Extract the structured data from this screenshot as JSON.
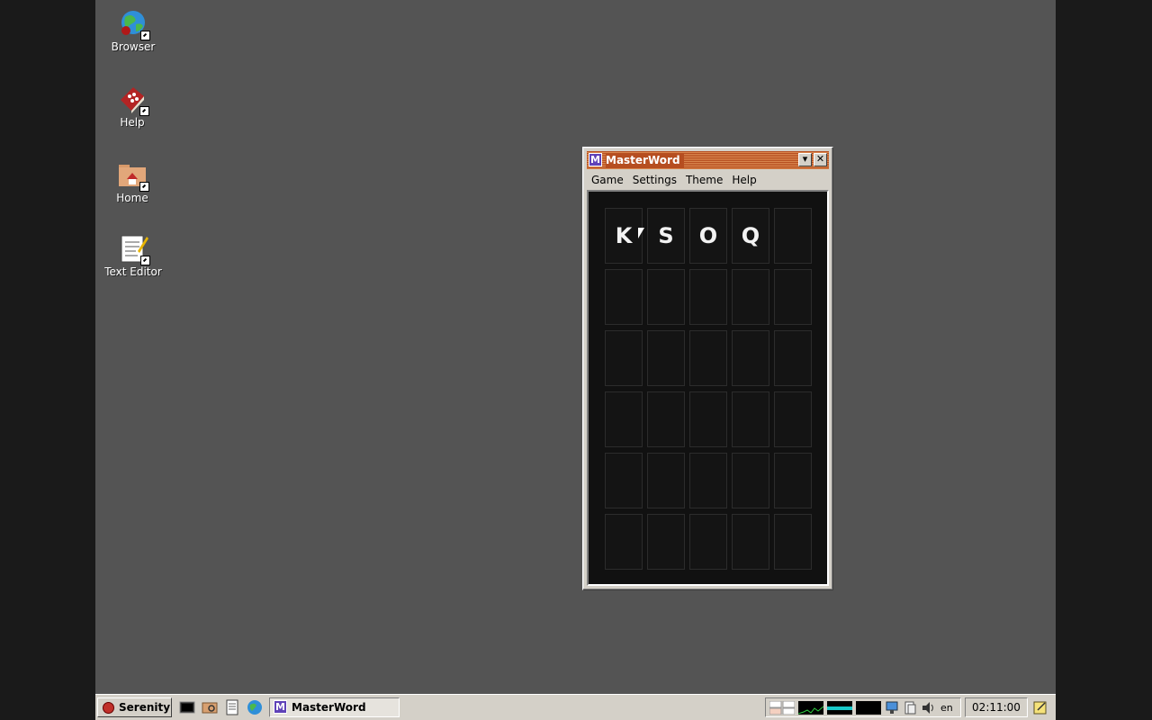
{
  "desktop": {
    "icons": [
      {
        "label": "Browser",
        "icon": "globe-icon"
      },
      {
        "label": "Help",
        "icon": "help-book-icon"
      },
      {
        "label": "Home",
        "icon": "home-folder-icon"
      },
      {
        "label": "Text Editor",
        "icon": "text-editor-icon"
      }
    ]
  },
  "window": {
    "title": "MasterWord",
    "app_icon_letter": "M",
    "menu": [
      "Game",
      "Settings",
      "Theme",
      "Help"
    ],
    "board": {
      "rows": [
        [
          "K",
          "S",
          "O",
          "Q",
          ""
        ],
        [
          "",
          "",
          "",
          "",
          ""
        ],
        [
          "",
          "",
          "",
          "",
          ""
        ],
        [
          "",
          "",
          "",
          "",
          ""
        ],
        [
          "",
          "",
          "",
          "",
          ""
        ],
        [
          "",
          "",
          "",
          "",
          ""
        ]
      ]
    }
  },
  "taskbar": {
    "start_label": "Serenity",
    "quick_launch": [
      "terminal-icon",
      "file-manager-icon",
      "text-editor-icon",
      "browser-icon"
    ],
    "task": {
      "label": "MasterWord",
      "icon_letter": "M"
    },
    "tray": {
      "keyboard_layout": "en",
      "clock": "02:11:00"
    }
  },
  "colors": {
    "desktop_bg": "#545454",
    "titlebar": "#b64e20",
    "board_bg": "#111111",
    "app_icon": "#5f42b8"
  }
}
